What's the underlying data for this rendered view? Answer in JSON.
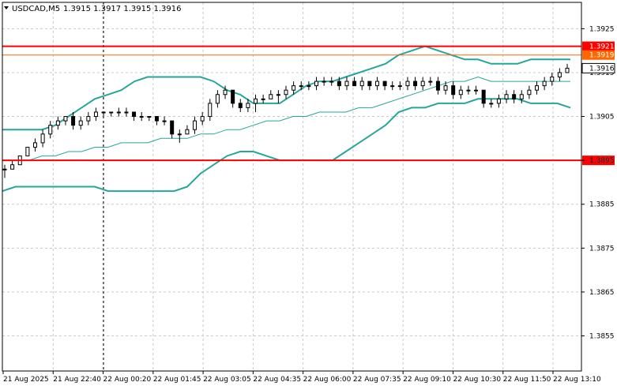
{
  "chart_data": {
    "type": "candlestick",
    "header": {
      "symbol_timeframe": "USDCAD,M5",
      "ohlc": "1.3915 1.3917 1.3915 1.3916"
    },
    "ylim": [
      1.3847,
      1.3931
    ],
    "y_ticks": [
      "1.3925",
      "1.3915",
      "1.3905",
      "1.3895",
      "1.3885",
      "1.3875",
      "1.3865",
      "1.3855"
    ],
    "x_labels": [
      "21 Aug 2025",
      "21 Aug 22:40",
      "22 Aug 00:20",
      "22 Aug 01:45",
      "22 Aug 03:05",
      "22 Aug 04:35",
      "22 Aug 06:00",
      "22 Aug 07:35",
      "22 Aug 09:10",
      "22 Aug 10:30",
      "22 Aug 11:50",
      "22 Aug 13:10"
    ],
    "grid": true,
    "horizontal_levels": [
      {
        "value": 1.3921,
        "label": "1.3921",
        "color": "#ff0000"
      },
      {
        "value": 1.3919,
        "label": "1.3919",
        "color": "#ff6600"
      },
      {
        "value": 1.3895,
        "label": "1.3895",
        "color": "#ff0000"
      }
    ],
    "current_price": {
      "value": 1.3916,
      "label": "1.3916"
    },
    "period_separator_index": 12,
    "series": [
      {
        "name": "",
        "kind": "bollinger_upper",
        "color": "#26a69a",
        "values": [
          1.3902,
          1.3902,
          1.3902,
          1.3902,
          1.3903,
          1.3905,
          1.3907,
          1.3909,
          1.391,
          1.3911,
          1.3913,
          1.3914,
          1.3914,
          1.3914,
          1.3914,
          1.3914,
          1.3913,
          1.3911,
          1.391,
          1.3908,
          1.3908,
          1.3908,
          1.391,
          1.3912,
          1.3913,
          1.3913,
          1.3914,
          1.3915,
          1.3916,
          1.3917,
          1.3919,
          1.392,
          1.3921,
          1.392,
          1.3919,
          1.3918,
          1.3918,
          1.3917,
          1.3917,
          1.3917,
          1.3918,
          1.3918,
          1.3918,
          1.3918
        ]
      },
      {
        "name": "",
        "kind": "moving_average",
        "color": "#26a69a",
        "values": [
          1.3895,
          1.3895,
          1.3895,
          1.3896,
          1.3896,
          1.3897,
          1.3897,
          1.3898,
          1.3898,
          1.3899,
          1.3899,
          1.3899,
          1.39,
          1.39,
          1.39,
          1.3901,
          1.3901,
          1.3902,
          1.3902,
          1.3903,
          1.3904,
          1.3904,
          1.3905,
          1.3905,
          1.3906,
          1.3906,
          1.3906,
          1.3907,
          1.3907,
          1.3908,
          1.3909,
          1.391,
          1.3911,
          1.3912,
          1.3913,
          1.3913,
          1.3914,
          1.3913,
          1.3913,
          1.3913,
          1.3913,
          1.3913,
          1.3913,
          1.3913
        ]
      },
      {
        "name": "",
        "kind": "bollinger_lower",
        "color": "#26a69a",
        "values": [
          1.3888,
          1.3889,
          1.3889,
          1.3889,
          1.3889,
          1.3889,
          1.3889,
          1.3889,
          1.3888,
          1.3888,
          1.3888,
          1.3888,
          1.3888,
          1.3888,
          1.3889,
          1.3892,
          1.3894,
          1.3896,
          1.3897,
          1.3897,
          1.3896,
          1.3895,
          1.3895,
          1.3895,
          1.3895,
          1.3895,
          1.3897,
          1.3899,
          1.3901,
          1.3903,
          1.3906,
          1.3907,
          1.3907,
          1.3908,
          1.3908,
          1.3908,
          1.3909,
          1.3909,
          1.3909,
          1.3909,
          1.3908,
          1.3908,
          1.3908,
          1.3907
        ]
      }
    ],
    "candles": [
      [
        1.3893,
        1.3894,
        1.3891,
        1.3893
      ],
      [
        1.3893,
        1.3895,
        1.3893,
        1.3894
      ],
      [
        1.3894,
        1.3896,
        1.3894,
        1.3896
      ],
      [
        1.3896,
        1.3898,
        1.3896,
        1.3898
      ],
      [
        1.3898,
        1.39,
        1.3897,
        1.3899
      ],
      [
        1.3899,
        1.3902,
        1.3898,
        1.3901
      ],
      [
        1.3901,
        1.3904,
        1.39,
        1.3903
      ],
      [
        1.3903,
        1.3905,
        1.3902,
        1.3904
      ],
      [
        1.3904,
        1.3905,
        1.3903,
        1.3905
      ],
      [
        1.3905,
        1.3906,
        1.3902,
        1.3903
      ],
      [
        1.3903,
        1.3905,
        1.3902,
        1.3904
      ],
      [
        1.3904,
        1.3906,
        1.3903,
        1.3905
      ],
      [
        1.3905,
        1.3907,
        1.3904,
        1.3906
      ],
      [
        1.3906,
        1.3906,
        1.3905,
        1.3906
      ],
      [
        1.3906,
        1.3906,
        1.3905,
        1.3906
      ],
      [
        1.3906,
        1.3907,
        1.3905,
        1.3906
      ],
      [
        1.3906,
        1.3907,
        1.3905,
        1.3906
      ],
      [
        1.3906,
        1.3906,
        1.3904,
        1.3905
      ],
      [
        1.3905,
        1.3906,
        1.3904,
        1.3905
      ],
      [
        1.3905,
        1.3905,
        1.3904,
        1.3905
      ],
      [
        1.3905,
        1.3905,
        1.3903,
        1.3904
      ],
      [
        1.3904,
        1.3905,
        1.3903,
        1.3904
      ],
      [
        1.3904,
        1.3904,
        1.39,
        1.3901
      ],
      [
        1.3901,
        1.3902,
        1.3899,
        1.3901
      ],
      [
        1.3901,
        1.3903,
        1.3901,
        1.3902
      ],
      [
        1.3902,
        1.3905,
        1.3901,
        1.3904
      ],
      [
        1.3904,
        1.3906,
        1.3903,
        1.3905
      ],
      [
        1.3905,
        1.3909,
        1.3904,
        1.3908
      ],
      [
        1.3908,
        1.3911,
        1.3907,
        1.391
      ],
      [
        1.391,
        1.3912,
        1.3909,
        1.3911
      ],
      [
        1.3911,
        1.3911,
        1.3907,
        1.3908
      ],
      [
        1.3908,
        1.3909,
        1.3906,
        1.3907
      ],
      [
        1.3907,
        1.3909,
        1.3906,
        1.3908
      ],
      [
        1.3908,
        1.391,
        1.3906,
        1.3909
      ],
      [
        1.3909,
        1.391,
        1.3908,
        1.3909
      ],
      [
        1.3909,
        1.3911,
        1.3909,
        1.391
      ],
      [
        1.391,
        1.3911,
        1.3908,
        1.391
      ],
      [
        1.391,
        1.3912,
        1.3909,
        1.3911
      ],
      [
        1.3911,
        1.3913,
        1.391,
        1.3912
      ],
      [
        1.3912,
        1.3913,
        1.3911,
        1.3912
      ],
      [
        1.3912,
        1.3913,
        1.3911,
        1.3912
      ],
      [
        1.3912,
        1.3914,
        1.3911,
        1.3913
      ],
      [
        1.3913,
        1.3914,
        1.3912,
        1.3913
      ],
      [
        1.3913,
        1.3914,
        1.3912,
        1.3913
      ],
      [
        1.3913,
        1.3914,
        1.3911,
        1.3912
      ],
      [
        1.3912,
        1.3914,
        1.3911,
        1.3913
      ],
      [
        1.3913,
        1.3914,
        1.3912,
        1.3912
      ],
      [
        1.3912,
        1.3914,
        1.3911,
        1.3913
      ],
      [
        1.3913,
        1.3913,
        1.3911,
        1.3912
      ],
      [
        1.3912,
        1.3914,
        1.3911,
        1.3913
      ],
      [
        1.3913,
        1.3913,
        1.3911,
        1.3912
      ],
      [
        1.3912,
        1.3913,
        1.3911,
        1.3912
      ],
      [
        1.3912,
        1.3913,
        1.3911,
        1.3912
      ],
      [
        1.3912,
        1.3914,
        1.3911,
        1.3913
      ],
      [
        1.3913,
        1.3914,
        1.3911,
        1.3912
      ],
      [
        1.3912,
        1.3914,
        1.3911,
        1.3913
      ],
      [
        1.3913,
        1.3914,
        1.3912,
        1.3913
      ],
      [
        1.3913,
        1.3914,
        1.391,
        1.3911
      ],
      [
        1.3911,
        1.3913,
        1.391,
        1.3912
      ],
      [
        1.3912,
        1.3913,
        1.3909,
        1.391
      ],
      [
        1.391,
        1.3912,
        1.3909,
        1.3911
      ],
      [
        1.3911,
        1.3912,
        1.391,
        1.3911
      ],
      [
        1.3911,
        1.3912,
        1.391,
        1.3911
      ],
      [
        1.3911,
        1.3911,
        1.3907,
        1.3908
      ],
      [
        1.3908,
        1.3909,
        1.3907,
        1.3908
      ],
      [
        1.3908,
        1.391,
        1.3907,
        1.3909
      ],
      [
        1.3909,
        1.3911,
        1.3908,
        1.391
      ],
      [
        1.391,
        1.3911,
        1.3908,
        1.3909
      ],
      [
        1.3909,
        1.3911,
        1.3908,
        1.391
      ],
      [
        1.391,
        1.3912,
        1.3909,
        1.3911
      ],
      [
        1.3911,
        1.3913,
        1.391,
        1.3912
      ],
      [
        1.3912,
        1.3914,
        1.3911,
        1.3913
      ],
      [
        1.3913,
        1.3915,
        1.3912,
        1.3914
      ],
      [
        1.3914,
        1.3916,
        1.3913,
        1.3915
      ],
      [
        1.3915,
        1.3917,
        1.3915,
        1.3916
      ]
    ]
  }
}
